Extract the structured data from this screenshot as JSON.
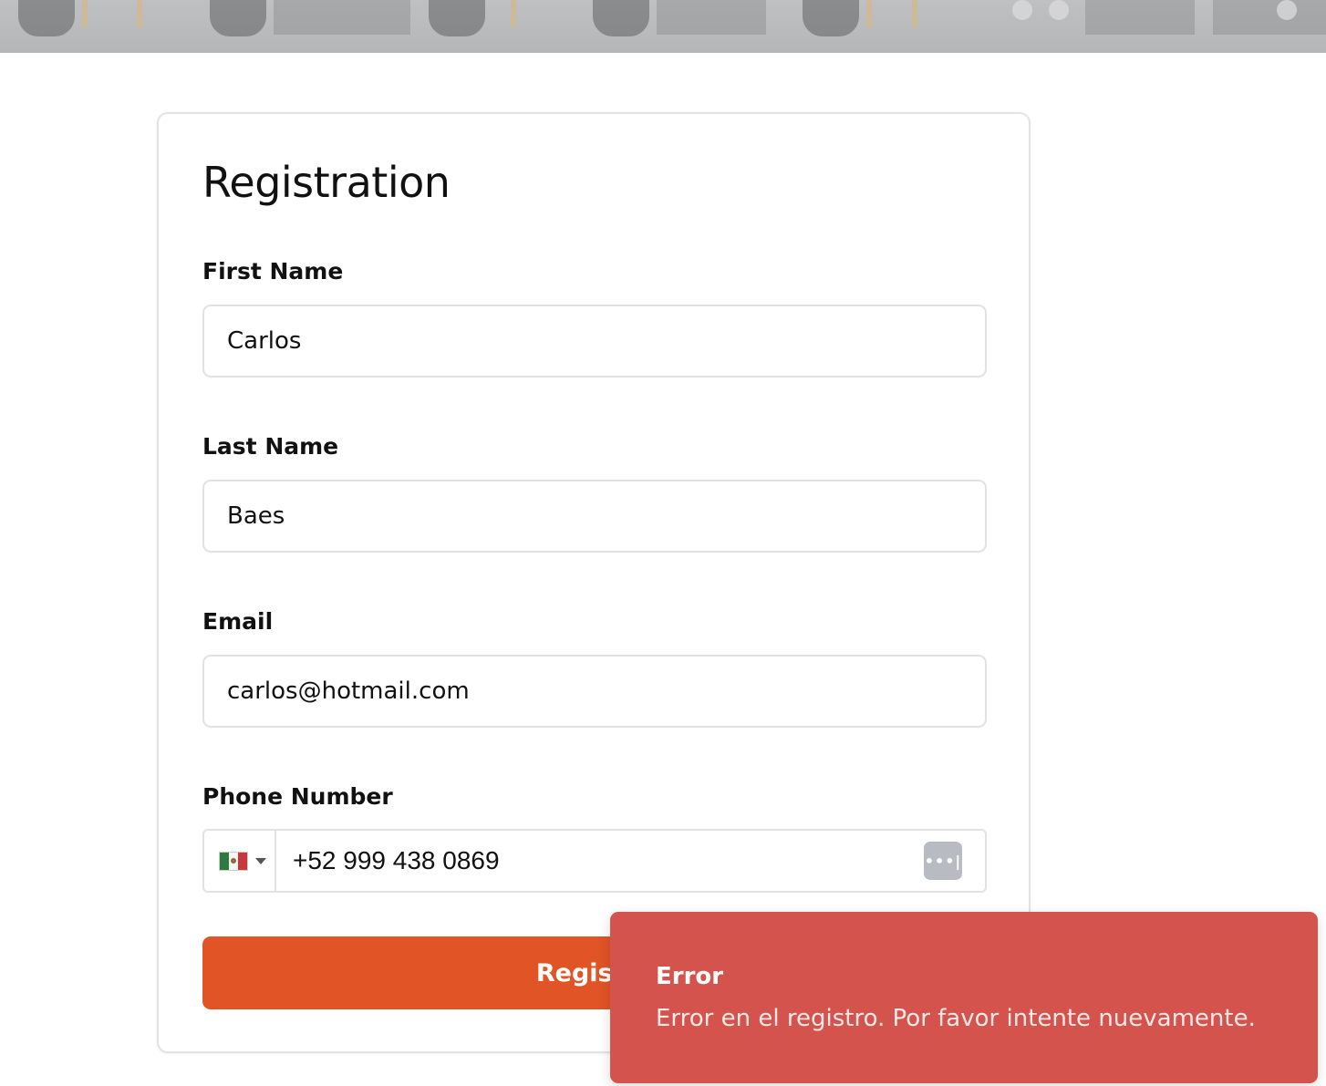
{
  "form": {
    "title": "Registration",
    "first_name": {
      "label": "First Name",
      "value": "Carlos"
    },
    "last_name": {
      "label": "Last Name",
      "value": "Baes"
    },
    "email": {
      "label": "Email",
      "value": "carlos@hotmail.com"
    },
    "phone": {
      "label": "Phone Number",
      "country": "Mexico",
      "value": "+52 999 438 0869"
    },
    "submit_label": "Register"
  },
  "toast": {
    "title": "Error",
    "message": "Error en el registro. Por favor intente nuevamente."
  },
  "colors": {
    "accent": "#e05426",
    "error": "#d4534c"
  },
  "icons": {
    "flag": "mexico-flag-icon",
    "caret": "caret-down-icon",
    "password_manager": "password-manager-icon"
  }
}
